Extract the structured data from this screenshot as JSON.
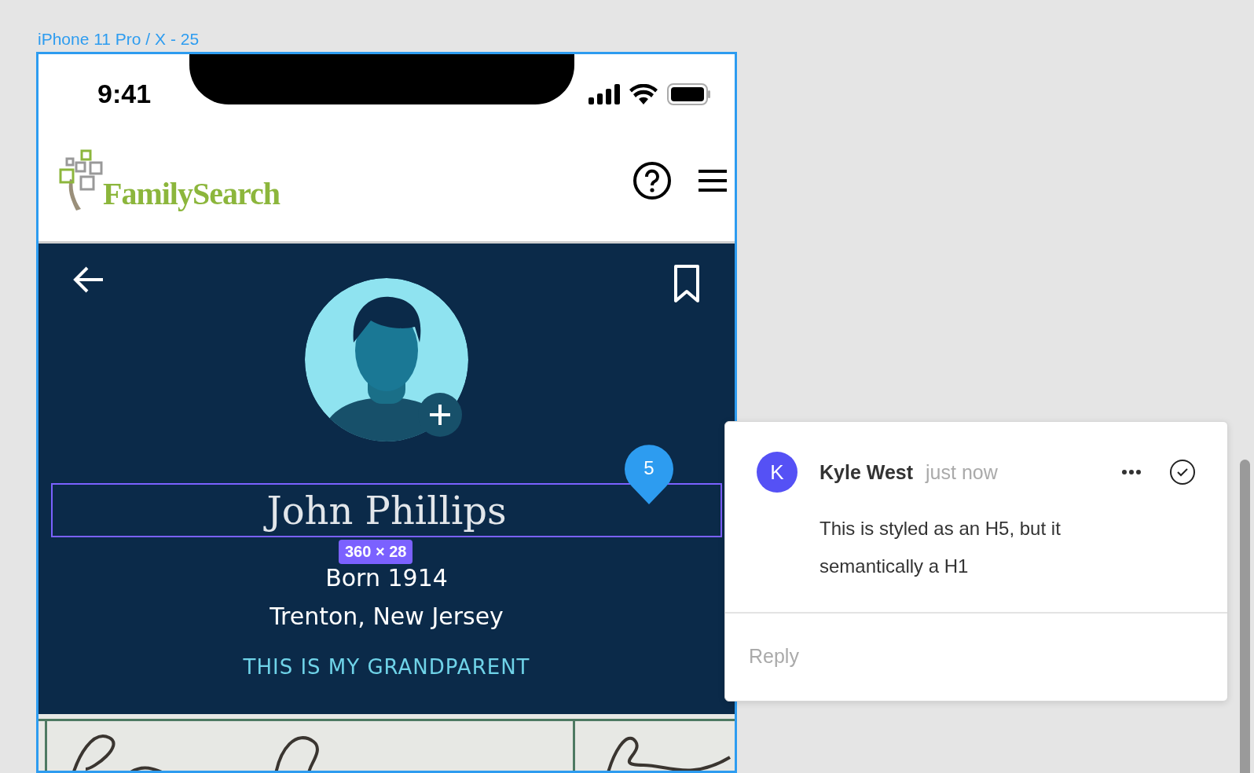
{
  "canvas": {
    "frame_label": "iPhone 11 Pro / X - 25"
  },
  "status_bar": {
    "time": "9:41"
  },
  "header": {
    "logo_text": "FamilySearch"
  },
  "profile": {
    "name": "John Phillips",
    "born": "Born 1914",
    "place": "Trenton, New Jersey",
    "relationship_link": "THIS IS MY GRANDPARENT"
  },
  "selection": {
    "size": "360 × 28"
  },
  "comment_pin": {
    "number": "5"
  },
  "comment": {
    "avatar_letter": "K",
    "author": "Kyle West",
    "time": "just now",
    "text": "This is styled as an H5, but it semantically a H1",
    "reply_placeholder": "Reply"
  }
}
